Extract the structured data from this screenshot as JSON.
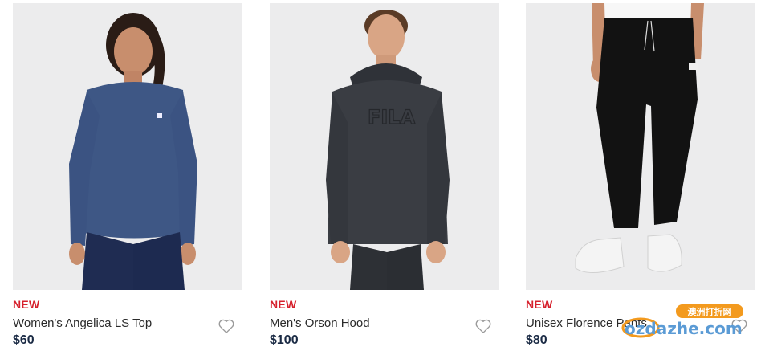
{
  "products": [
    {
      "badge": "NEW",
      "name": "Women's Angelica LS Top",
      "price": "$60",
      "image_icon": "product-photo-womens-top"
    },
    {
      "badge": "NEW",
      "name": "Men's Orson Hood",
      "price": "$100",
      "image_icon": "product-photo-mens-hood"
    },
    {
      "badge": "NEW",
      "name": "Unisex Florence Pants",
      "price": "$80",
      "image_icon": "product-photo-pants"
    }
  ],
  "watermark": {
    "top": "澳洲打折网",
    "bottom": "ozdazhe.com"
  },
  "colors": {
    "badge": "#d6202c",
    "price": "#1a2a44",
    "text": "#2a2a2a",
    "image_bg": "#ececed"
  }
}
